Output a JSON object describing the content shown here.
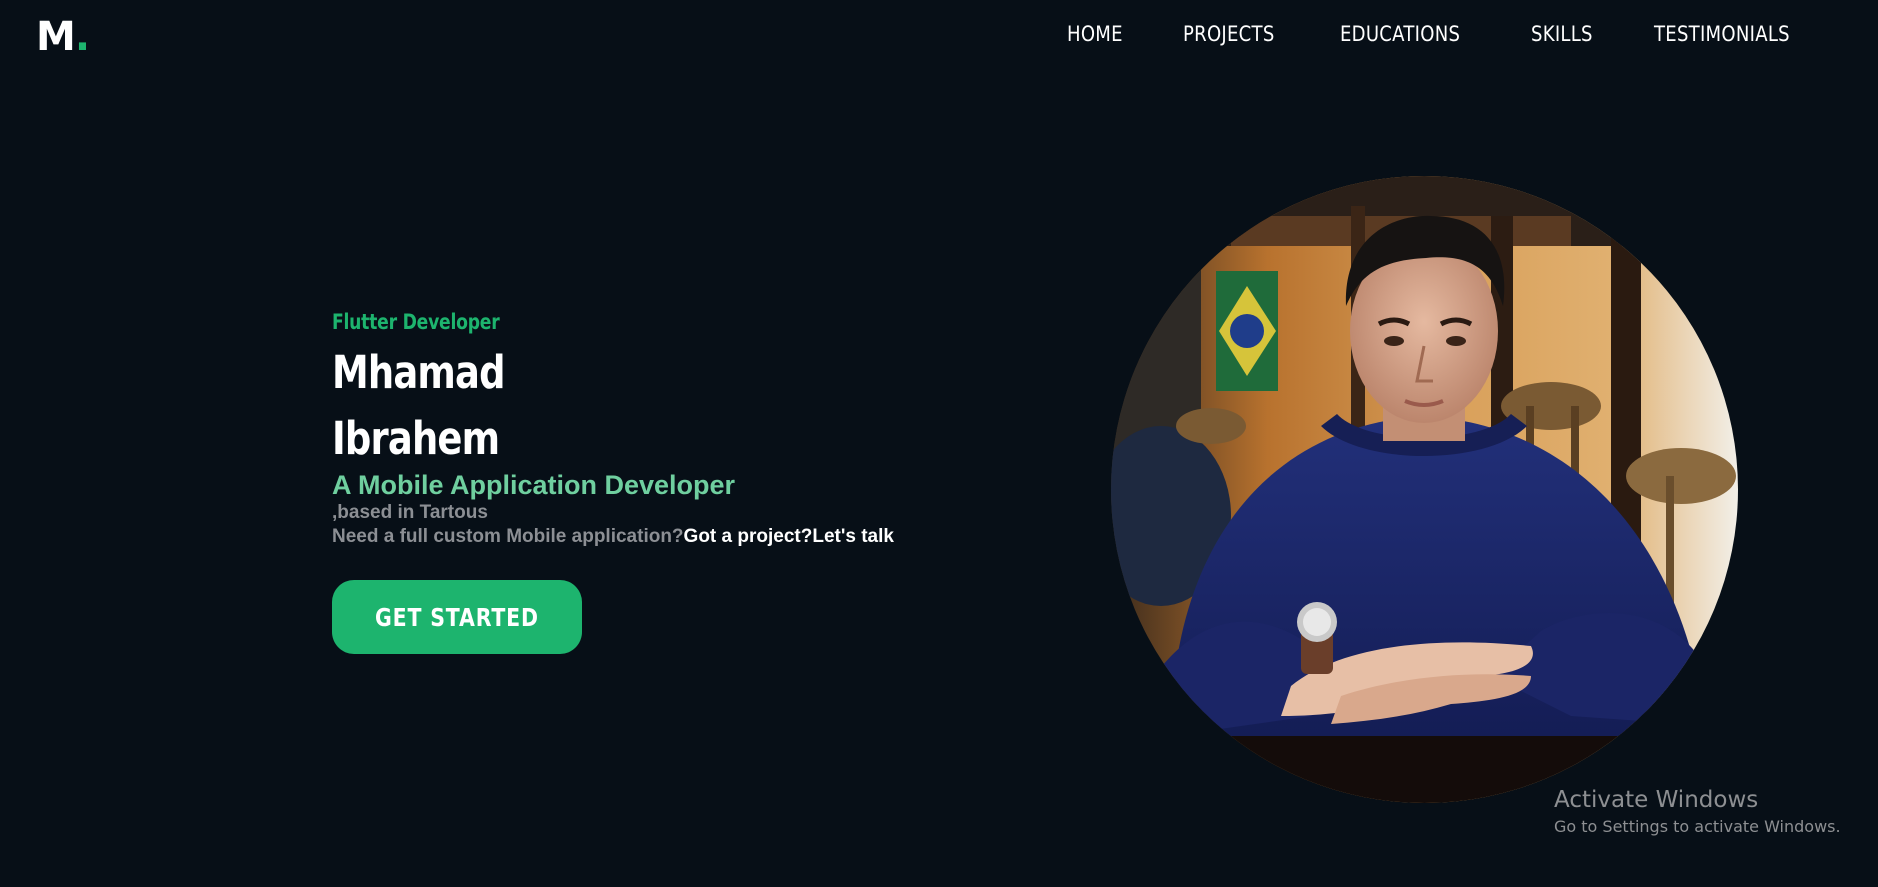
{
  "header": {
    "logo_letter": "M",
    "logo_dot": ".",
    "nav": [
      "HOME",
      "PROJECTS",
      "EDUCATIONS",
      "SKILLS",
      "TESTIMONIALS"
    ]
  },
  "hero": {
    "role": "Flutter Developer",
    "first_name": "Mhamad",
    "last_name": "Ibrahem",
    "subtitle": "A Mobile Application Developer",
    "based": ",based in Tartous",
    "need_text": "Need a full custom Mobile application?",
    "cta_text": "Got a project?Let's talk",
    "button_label": "GET STARTED"
  },
  "watermark": {
    "title": "Activate Windows",
    "subtitle": "Go to Settings to activate Windows."
  },
  "colors": {
    "background": "#070f17",
    "accent": "#1db46e",
    "subtitle": "#6fcf9f",
    "muted_text": "#8c8f94"
  }
}
